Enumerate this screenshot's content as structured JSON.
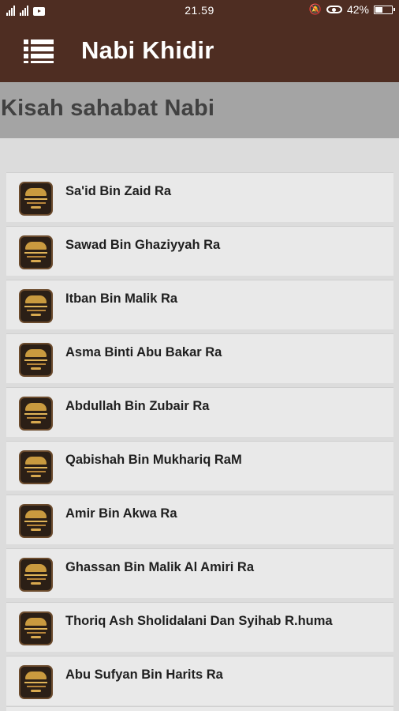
{
  "status_bar": {
    "time": "21.59",
    "battery": "42%",
    "battery_level": 0.42,
    "icons": [
      "signal-icon",
      "signal-icon",
      "youtube-icon",
      "bell-muted-icon",
      "eye-icon",
      "battery-icon"
    ]
  },
  "app_bar": {
    "menu_icon": "list-menu-icon",
    "title": "Nabi Khidir"
  },
  "section": {
    "title": "Kisah sahabat Nabi"
  },
  "items": [
    {
      "label": "Sa'id Bin Zaid Ra"
    },
    {
      "label": "Sawad Bin Ghaziyyah Ra"
    },
    {
      "label": "Itban Bin Malik Ra"
    },
    {
      "label": "Asma Binti Abu Bakar Ra"
    },
    {
      "label": "Abdullah Bin Zubair Ra"
    },
    {
      "label": "Qabishah Bin Mukhariq RaM"
    },
    {
      "label": "Amir Bin Akwa Ra"
    },
    {
      "label": "Ghassan Bin Malik Al Amiri Ra"
    },
    {
      "label": "Thoriq Ash Sholidalani Dan Syihab R.huma"
    },
    {
      "label": "Abu Sufyan Bin Harits Ra"
    }
  ],
  "colors": {
    "app_bar": "#4e2d22",
    "section_header": "#a4a4a4",
    "background": "#dcdcdc",
    "item_background": "#e9e9e9"
  }
}
